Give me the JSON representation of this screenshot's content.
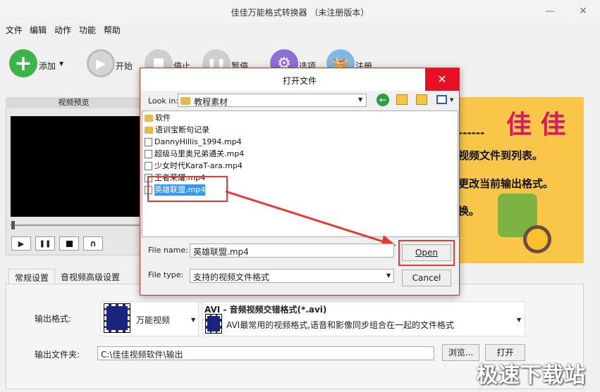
{
  "window": {
    "title": "佳佳万能格式转换器 （未注册版本）"
  },
  "menu": [
    "文件",
    "编辑",
    "动作",
    "功能",
    "帮助"
  ],
  "toolbar": {
    "add": "添加",
    "start": "开始",
    "stop": "停止",
    "pause": "暂停",
    "options": "选项",
    "register": "注册"
  },
  "preview": {
    "header": "视频预览"
  },
  "banner": {
    "brand": "佳 佳",
    "dashes": "------",
    "line1": "视频文件到列表。",
    "line2": "更改当前输出格式。",
    "line3": "换。"
  },
  "tabs": [
    "常规设置",
    "音视频高级设置"
  ],
  "settings": {
    "output_format_label": "输出格式:",
    "format_category": "万能视频",
    "format_name": "AVI - 音频视频交错格式(*.avi)",
    "format_desc": "AVI最常用的视频格式,语音和影像同步组合在一起的文件格式",
    "output_folder_label": "输出文件夹:",
    "output_folder_value": "C:\\佳佳视频软件\\输出",
    "browse": "浏览...",
    "open": "打开"
  },
  "dialog": {
    "title": "打开文件",
    "look_in_label": "Look in:",
    "look_in_value": "教程素材",
    "files": [
      {
        "name": "软件",
        "type": "folder"
      },
      {
        "name": "语训宝断句记录",
        "type": "folder"
      },
      {
        "name": "DannyHillis_1994.mp4",
        "type": "file"
      },
      {
        "name": "超级马里奥兄弟通关.mp4",
        "type": "file"
      },
      {
        "name": "少女时代KaraT-ara.mp4",
        "type": "file"
      },
      {
        "name": "王者荣耀.mp4",
        "type": "file"
      },
      {
        "name": "英雄联盟.mp4",
        "type": "file"
      }
    ],
    "file_name_label": "File name:",
    "file_name_value": "英雄联盟.mp4",
    "file_type_label": "File type:",
    "file_type_value": "支持的视频文件格式",
    "open_button": "Open",
    "cancel_button": "Cancel"
  },
  "watermark": "极速下载站",
  "colors": {
    "accent_red": "#e53935",
    "selection": "#3399ff",
    "banner": "#f9c64a"
  }
}
